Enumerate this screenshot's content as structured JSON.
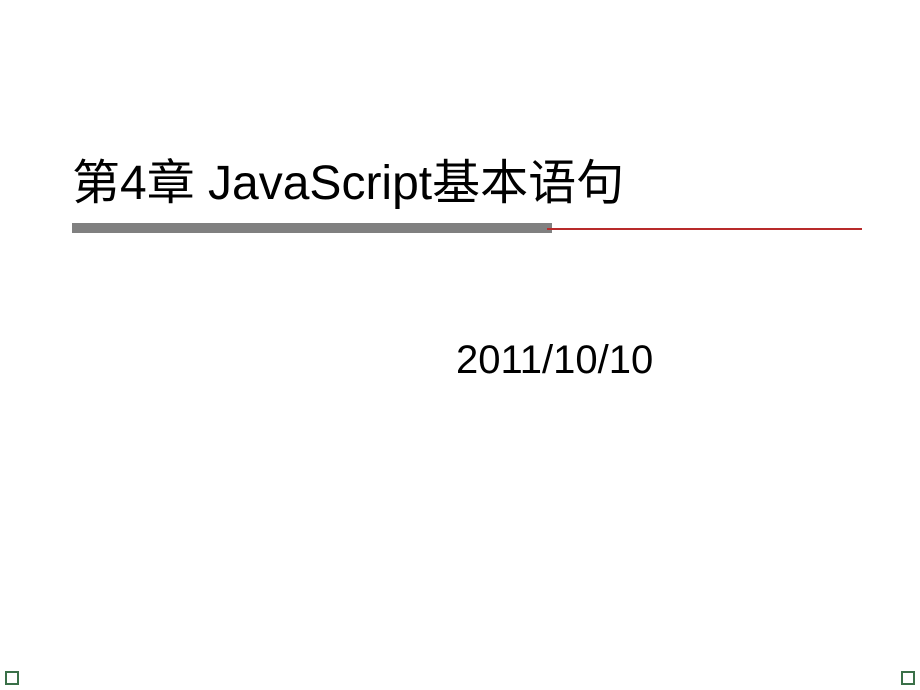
{
  "slide": {
    "title": "第4章  JavaScript基本语句",
    "date": "2011/10/10"
  }
}
